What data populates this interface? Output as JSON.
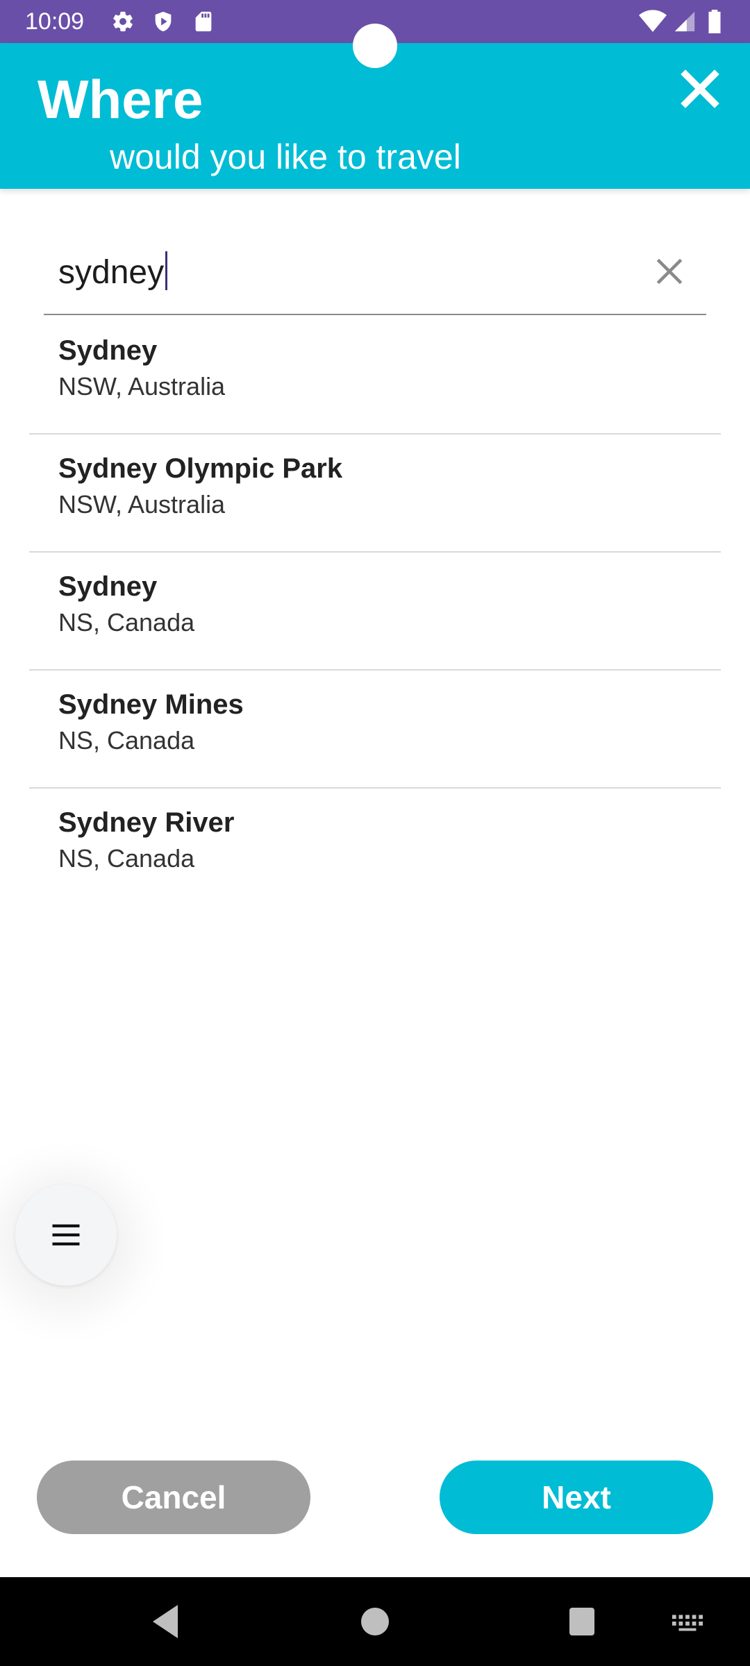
{
  "status_bar": {
    "time": "10:09"
  },
  "header": {
    "title": "Where",
    "subtitle": "would you like to travel",
    "close_icon": "close-icon"
  },
  "search": {
    "value": "sydney",
    "clear_icon": "clear-icon"
  },
  "results": [
    {
      "name": "Sydney",
      "region": "NSW, Australia"
    },
    {
      "name": "Sydney Olympic Park",
      "region": "NSW, Australia"
    },
    {
      "name": "Sydney",
      "region": "NS, Canada"
    },
    {
      "name": "Sydney Mines",
      "region": "NS, Canada"
    },
    {
      "name": "Sydney River",
      "region": "NS, Canada"
    }
  ],
  "fab": {
    "icon": "menu-icon"
  },
  "buttons": {
    "cancel_label": "Cancel",
    "next_label": "Next"
  },
  "colors": {
    "status_bar": "#6a4fa8",
    "accent": "#00bcd4",
    "cancel": "#a0a0a0"
  }
}
